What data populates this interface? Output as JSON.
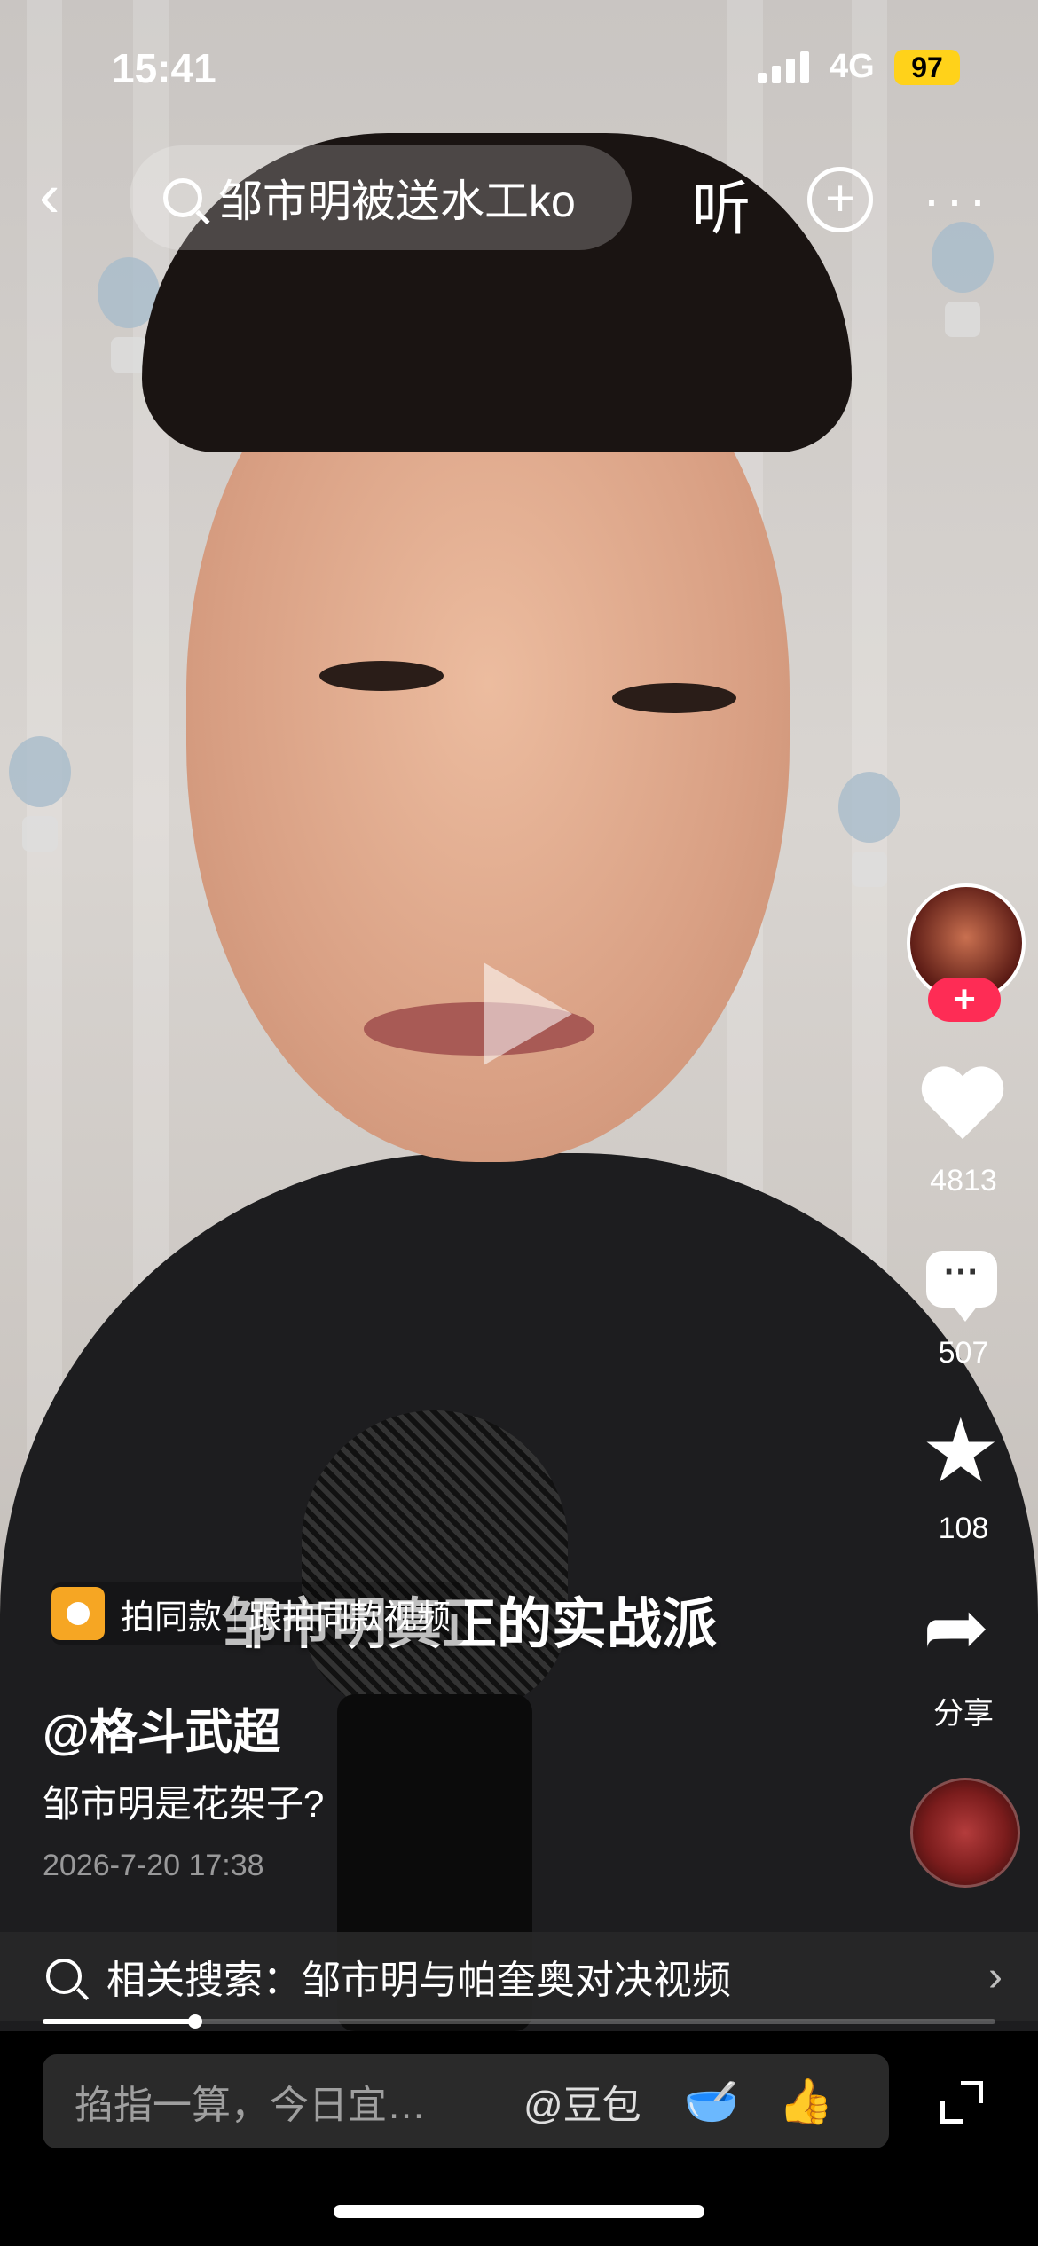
{
  "status_bar": {
    "time": "15:41",
    "network": "4G",
    "battery": "97"
  },
  "top_bar": {
    "search_text": "邹市明被送水工ko",
    "listen_label": "听"
  },
  "overlay": {
    "shoot_same": "拍同款",
    "follow_shoot": "跟拍同款视频",
    "subtitle": "邹市明真正的实战派"
  },
  "rail": {
    "likes": "4813",
    "comments": "507",
    "favorites": "108",
    "share_label": "分享"
  },
  "post": {
    "author": "@格斗武超",
    "description": "邹市明是花架子?",
    "date": "2026-7-20 17:38"
  },
  "related": {
    "text": "相关搜索：邹市明与帕奎奥对决视频"
  },
  "progress": {
    "fraction": 0.16
  },
  "comment_bar": {
    "placeholder": "掐指一算，今日宜…",
    "doubao": "@豆包",
    "emoji_1": "🥣",
    "emoji_2": "👍"
  }
}
